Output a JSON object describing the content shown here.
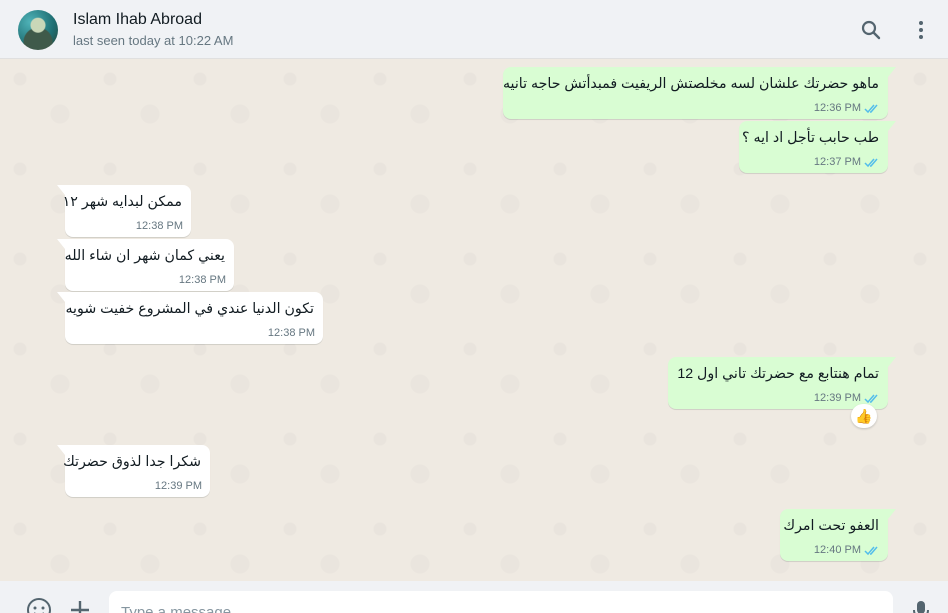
{
  "header": {
    "contact_name": "Islam Ihab Abroad",
    "status": "last seen today at 10:22 AM",
    "avatar_icon": "profile-photo",
    "search_icon": "search-icon",
    "menu_icon": "kebab-menu-icon"
  },
  "messages": [
    {
      "direction": "out",
      "text": "ماهو حضرتك علشان لسه مخلصتش الريفيت فمبدأتش حاجه تانيه",
      "time": "12:36 PM",
      "status": "read"
    },
    {
      "direction": "out",
      "text": "طب حابب تأجل اد ايه ؟",
      "time": "12:37 PM",
      "status": "read"
    },
    {
      "direction": "in",
      "text": "ممكن لبدايه شهر ١٢",
      "time": "12:38 PM"
    },
    {
      "direction": "in",
      "text": "يعني كمان شهر ان شاء الله",
      "time": "12:38 PM"
    },
    {
      "direction": "in",
      "text": "تكون الدنيا عندي في المشروع خفيت شويه",
      "time": "12:38 PM"
    },
    {
      "direction": "out",
      "text": "تمام هنتابع مع حضرتك تاني اول 12",
      "time": "12:39 PM",
      "status": "read",
      "reaction": "👍"
    },
    {
      "direction": "in",
      "text": "شكرا جدا لذوق حضرتك",
      "time": "12:39 PM"
    },
    {
      "direction": "out",
      "text": "العفو تحت امرك",
      "time": "12:40 PM",
      "status": "read"
    }
  ],
  "composer": {
    "placeholder": "Type a message",
    "emoji_icon": "emoji-icon",
    "attach_icon": "plus-icon",
    "mic_icon": "microphone-icon"
  },
  "colors": {
    "outgoing_bubble": "#d9fdd3",
    "incoming_bubble": "#ffffff",
    "chat_background": "#efeae2",
    "read_ticks": "#53bdeb",
    "header_background": "#f0f2f5"
  }
}
